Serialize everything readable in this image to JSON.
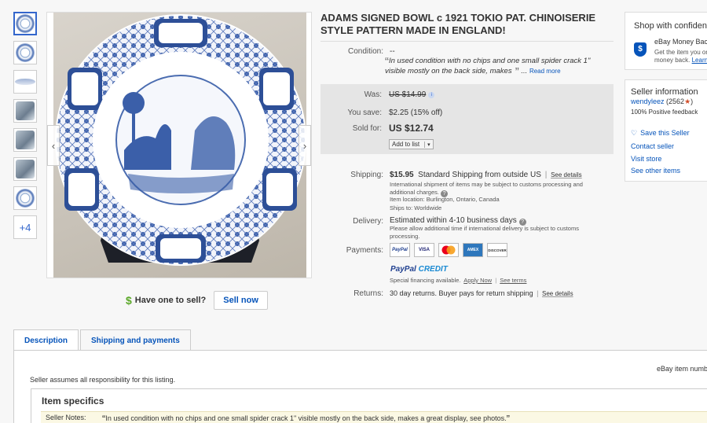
{
  "thumbnails": {
    "count": 7,
    "more_label": "+4"
  },
  "sell": {
    "question": "Have one to sell?",
    "button": "Sell now",
    "dollar": "$"
  },
  "title": "ADAMS SIGNED BOWL c 1921 TOKIO PAT. CHINOISERIE STYLE PATTERN MADE IN ENGLAND!",
  "condition": {
    "label": "Condition:",
    "value": "--",
    "description": "In used condition with no chips and one small spider crack 1\" visible mostly on the back side, makes",
    "ellipsis": "...",
    "read_more": "Read more"
  },
  "price": {
    "was_label": "Was:",
    "was_value": "US $14.99",
    "save_label": "You save:",
    "save_value": "$2.25 (15% off)",
    "sold_label": "Sold for:",
    "sold_value": "US $12.74",
    "add_to_list": "Add to list"
  },
  "shipping": {
    "label": "Shipping:",
    "cost": "$15.95",
    "method": "Standard Shipping from outside US",
    "see_details": "See details",
    "note": "International shipment of items may be subject to customs processing and additional charges.",
    "location": "Item location:  Burlington, Ontario, Canada",
    "ships_to": "Ships to:  Worldwide"
  },
  "delivery": {
    "label": "Delivery:",
    "estimate": "Estimated within 4-10 business days",
    "note": "Please allow additional time if international delivery is subject to customs processing."
  },
  "payments": {
    "label": "Payments:",
    "cards": [
      "PayPal",
      "VISA",
      "MC",
      "AMEX",
      "DISCOVER"
    ],
    "paypal": "PayPal",
    "credit": "CREDIT",
    "financing": "Special financing available.",
    "apply_now": "Apply Now",
    "see_terms": "See terms"
  },
  "returns": {
    "label": "Returns:",
    "text": "30 day returns. Buyer pays for return shipping",
    "see_details": "See details"
  },
  "shop_confidence": {
    "heading": "Shop with confidence",
    "money_back": "eBay Money Back Guarantee",
    "desc": "Get the item you ordered or get your",
    "desc2": "money back.",
    "learn": "Learn more"
  },
  "seller": {
    "heading": "Seller information",
    "name": "wendyleez",
    "score": "(2562",
    "score_close": ")",
    "feedback": "100% Positive feedback",
    "save": "Save this Seller",
    "contact": "Contact seller",
    "visit": "Visit store",
    "other": "See other items"
  },
  "tabs": [
    "Description",
    "Shipping and payments"
  ],
  "description": {
    "item_number": "eBay item number:",
    "assumes": "Seller assumes all responsibility for this listing.",
    "specifics_title": "Item specifics",
    "notes_label": "Seller Notes:",
    "notes_value": "In used condition with no chips and one small spider crack 1\" visible mostly on the back side, makes a great display, see photos."
  },
  "colors": {
    "link": "#0654ba",
    "price_box": "#e5e5e5",
    "star": "#d14e2a"
  }
}
